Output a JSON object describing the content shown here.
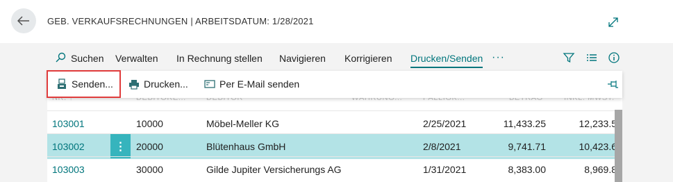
{
  "header": {
    "title": "GEB. VERKAUFSRECHNUNGEN | ARBEITSDATUM: 1/28/2021"
  },
  "actions": {
    "search": "Suchen",
    "manage": "Verwalten",
    "invoice": "In Rechnung stellen",
    "navigate": "Navigieren",
    "correct": "Korrigieren",
    "print_send": "Drucken/Senden",
    "more": "···"
  },
  "subactions": {
    "send": "Senden...",
    "print": "Drucken...",
    "email": "Per E-Mail senden"
  },
  "columns": [
    "NR. ↑",
    "DEBITORE...",
    "DEBITOR",
    "WÄHRUNG...",
    "FÄLLIGK...",
    "BETRAG",
    "INKL. MWST."
  ],
  "rows": [
    {
      "no": "103001",
      "customer_no": "10000",
      "customer": "Möbel-Meller KG",
      "due": "2/25/2021",
      "amount": "11,433.25",
      "incl_vat": "12,233.5"
    },
    {
      "no": "103002",
      "customer_no": "20000",
      "customer": "Blütenhaus GmbH",
      "due": "2/8/2021",
      "amount": "9,741.71",
      "incl_vat": "10,423.6"
    },
    {
      "no": "103003",
      "customer_no": "30000",
      "customer": "Gilde Jupiter Versicherungs AG",
      "due": "1/31/2021",
      "amount": "8,383.00",
      "incl_vat": "8,969.8"
    }
  ],
  "row_menu": "⋮",
  "colors": {
    "accent": "#00757c",
    "selected_row": "#b3e3e6",
    "highlight": "#e03c3c"
  }
}
